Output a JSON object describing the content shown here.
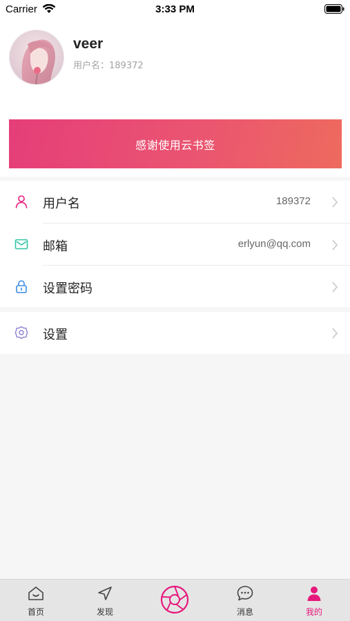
{
  "status_bar": {
    "carrier": "Carrier",
    "time": "3:33 PM"
  },
  "profile": {
    "name": "veer",
    "username_line": "用户名：189372",
    "banner_text": "感谢使用云书签"
  },
  "menu": {
    "items": [
      {
        "label": "用户名",
        "value": "189372",
        "icon": "person-icon"
      },
      {
        "label": "邮箱",
        "value": "erlyun@qq.com",
        "icon": "mail-icon"
      },
      {
        "label": "设置密码",
        "value": "",
        "icon": "lock-icon"
      },
      {
        "label": "设置",
        "value": "",
        "icon": "gear-icon"
      }
    ]
  },
  "tabs": [
    {
      "label": "首页",
      "icon": "home-icon"
    },
    {
      "label": "发现",
      "icon": "compass-icon"
    },
    {
      "label": "",
      "icon": "aperture-icon"
    },
    {
      "label": "消息",
      "icon": "chat-icon"
    },
    {
      "label": "我的",
      "icon": "user-icon",
      "active": true
    }
  ],
  "colors": {
    "accent": "#e6197c",
    "banner_start": "#e53e79",
    "banner_end": "#ee6a5e",
    "mail_icon": "#2ec4a6",
    "lock_icon": "#3a8ee6",
    "gear_icon": "#8a7fd0"
  }
}
